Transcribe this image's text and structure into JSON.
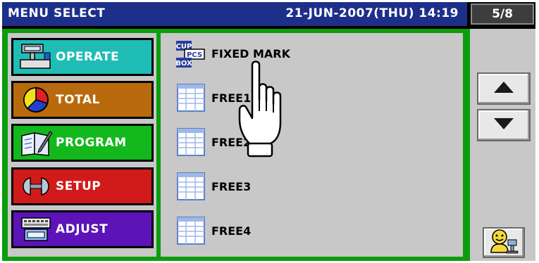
{
  "header": {
    "title": "MENU SELECT",
    "datetime": "21-JUN-2007(THU) 14:19",
    "page": "5/8"
  },
  "menu": [
    {
      "label": "OPERATE",
      "icon": "scale-icon",
      "color": "#1fbdb5"
    },
    {
      "label": "TOTAL",
      "icon": "pie-chart-icon",
      "color": "#b86a0c"
    },
    {
      "label": "PROGRAM",
      "icon": "book-pencil-icon",
      "color": "#13b81d"
    },
    {
      "label": "SETUP",
      "icon": "wrench-icon",
      "color": "#d11b1b"
    },
    {
      "label": "ADJUST",
      "icon": "keyboard-monitor-icon",
      "color": "#5c13b8"
    }
  ],
  "items": [
    {
      "label": "FIXED MARK",
      "icon": "cup-pcs-box-icon"
    },
    {
      "label": "FREE1",
      "icon": "free-label-icon"
    },
    {
      "label": "FREE2",
      "icon": "free-label-icon"
    },
    {
      "label": "FREE3",
      "icon": "free-label-icon"
    },
    {
      "label": "FREE4",
      "icon": "free-label-icon"
    }
  ],
  "icon_texts": {
    "cup": "CUP",
    "pcs": "PCS",
    "box": "BOX"
  },
  "nav": {
    "up_icon": "triangle-up-icon",
    "down_icon": "triangle-down-icon",
    "assist_icon": "operator-icon"
  },
  "colors": {
    "title_bar": "#1e2f8a",
    "frame_green": "#0c9d0c",
    "panel_gray": "#c8c8c8"
  }
}
